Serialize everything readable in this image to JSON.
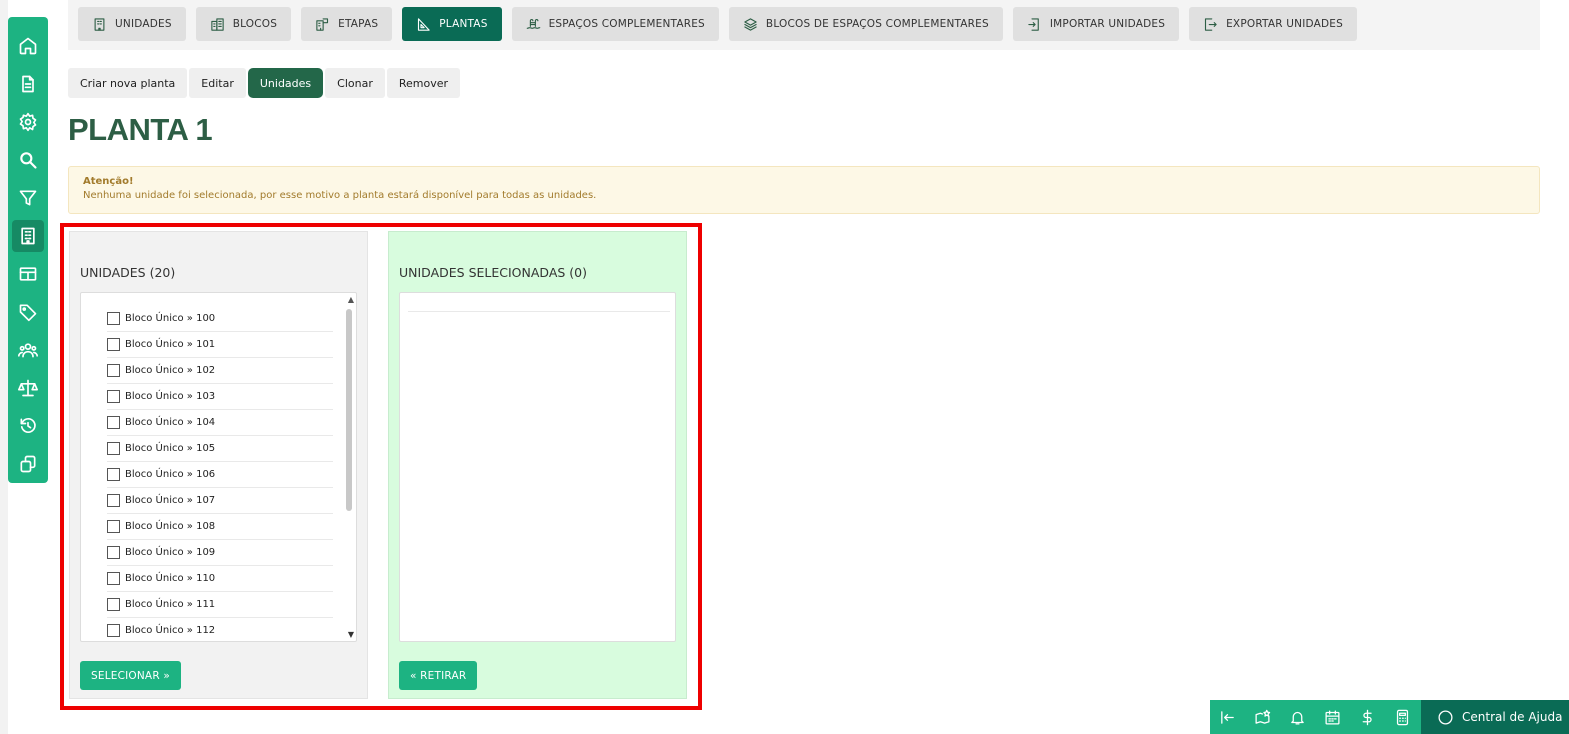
{
  "sidebar": {
    "items": [
      {
        "icon": "home-icon"
      },
      {
        "icon": "document-icon"
      },
      {
        "icon": "gear-icon"
      },
      {
        "icon": "search-icon"
      },
      {
        "icon": "filter-icon"
      },
      {
        "icon": "building-icon",
        "active": true
      },
      {
        "icon": "table-icon"
      },
      {
        "icon": "tag-icon"
      },
      {
        "icon": "users-icon"
      },
      {
        "icon": "scale-icon"
      },
      {
        "icon": "history-icon"
      },
      {
        "icon": "copy-icon"
      }
    ]
  },
  "topnav": {
    "tabs": [
      {
        "label": "UNIDADES",
        "icon": "building-icon"
      },
      {
        "label": "BLOCOS",
        "icon": "buildings-icon"
      },
      {
        "label": "ETAPAS",
        "icon": "stages-icon"
      },
      {
        "label": "PLANTAS",
        "icon": "set-square-icon",
        "active": true
      },
      {
        "label": "ESPAÇOS COMPLEMENTARES",
        "icon": "pool-icon"
      },
      {
        "label": "BLOCOS DE ESPAÇOS COMPLEMENTARES",
        "icon": "layers-icon"
      },
      {
        "label": "IMPORTAR UNIDADES",
        "icon": "import-icon"
      },
      {
        "label": "EXPORTAR UNIDADES",
        "icon": "export-icon"
      }
    ]
  },
  "subnav": {
    "buttons": [
      {
        "label": "Criar nova planta"
      },
      {
        "label": "Editar"
      },
      {
        "label": "Unidades",
        "active": true
      },
      {
        "label": "Clonar"
      },
      {
        "label": "Remover"
      }
    ]
  },
  "page": {
    "title": "PLANTA 1"
  },
  "alert": {
    "title": "Atenção!",
    "text": "Nenhuma unidade foi selecionada, por esse motivo a planta estará disponível para todas as unidades."
  },
  "available": {
    "title": "UNIDADES (20)",
    "items": [
      "Bloco Único » 100",
      "Bloco Único » 101",
      "Bloco Único » 102",
      "Bloco Único » 103",
      "Bloco Único » 104",
      "Bloco Único » 105",
      "Bloco Único » 106",
      "Bloco Único » 107",
      "Bloco Único » 108",
      "Bloco Único » 109",
      "Bloco Único » 110",
      "Bloco Único » 111",
      "Bloco Único » 112"
    ],
    "button": "SELECIONAR »"
  },
  "selected": {
    "title": "UNIDADES SELECIONADAS (0)",
    "button": "« RETIRAR"
  },
  "bottom_bar": {
    "icons": [
      "collapse-left-icon",
      "map-star-icon",
      "bell-icon",
      "calendar-icon",
      "dollar-icon",
      "calculator-icon"
    ],
    "help_label": "Central de Ajuda"
  },
  "colors": {
    "primary": "#1db382",
    "dark": "#0a6b55",
    "title": "#2d5e45",
    "highlight": "#ee0000"
  }
}
